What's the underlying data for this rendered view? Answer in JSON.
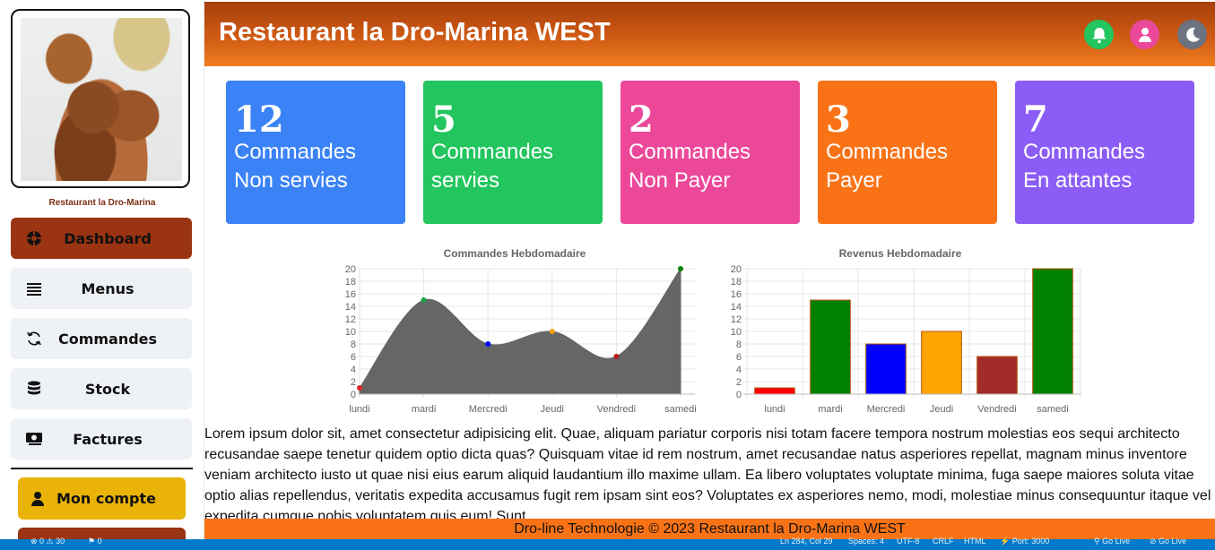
{
  "sidebar": {
    "caption": "Restaurant la Dro-Marina",
    "items": [
      {
        "label": "Dashboard",
        "icon": "dashboard-icon"
      },
      {
        "label": "Menus",
        "icon": "list-icon"
      },
      {
        "label": "Commandes",
        "icon": "refresh-icon"
      },
      {
        "label": "Stock",
        "icon": "database-icon"
      },
      {
        "label": "Factures",
        "icon": "money-bill-icon"
      }
    ],
    "account_label": "Mon compte"
  },
  "header": {
    "title": "Restaurant la Dro-Marina WEST",
    "buttons": [
      {
        "icon": "bell-icon",
        "color": "#22c55e"
      },
      {
        "icon": "user-icon",
        "color": "#ec4899"
      },
      {
        "icon": "moon-icon",
        "color": "#6b7280"
      }
    ]
  },
  "stats": [
    {
      "value": "12",
      "line1": "Commandes",
      "line2": "Non servies",
      "color": "#3b82f6"
    },
    {
      "value": "5",
      "line1": "Commandes",
      "line2": "servies",
      "color": "#22c55e"
    },
    {
      "value": "2",
      "line1": "Commandes",
      "line2": "Non Payer",
      "color": "#ec4899"
    },
    {
      "value": "3",
      "line1": "Commandes",
      "line2": "Payer",
      "color": "#f97316"
    },
    {
      "value": "7",
      "line1": "Commandes",
      "line2": "En attantes",
      "color": "#8b5cf6"
    }
  ],
  "chart_data": [
    {
      "type": "area",
      "title": "Commandes Hebdomadaire",
      "categories": [
        "lundi",
        "mardi",
        "Mercredi",
        "Jeudi",
        "Vendredi",
        "samedi"
      ],
      "values": [
        1,
        15,
        8,
        10,
        6,
        20
      ],
      "point_colors": [
        "#dc2626",
        "#16a34a",
        "#0000ff",
        "#f59e0b",
        "#b91c1c",
        "#008000"
      ],
      "fill_color": "#666666",
      "ylim": [
        0,
        20
      ],
      "yticks": [
        0,
        2,
        4,
        6,
        8,
        10,
        12,
        14,
        16,
        18,
        20
      ]
    },
    {
      "type": "bar",
      "title": "Revenus Hebdomadaire",
      "categories": [
        "lundi",
        "mardi",
        "Mercredi",
        "Jeudi",
        "Vendredi",
        "samedi"
      ],
      "values": [
        1,
        15,
        8,
        10,
        6,
        20
      ],
      "bar_colors": [
        "#ff0000",
        "#008000",
        "#0000ff",
        "#ffa500",
        "#a52a2a",
        "#008000"
      ],
      "ylim": [
        0,
        20
      ],
      "yticks": [
        0,
        2,
        4,
        6,
        8,
        10,
        12,
        14,
        16,
        18,
        20
      ]
    }
  ],
  "body_text": "Lorem ipsum dolor sit, amet consectetur adipisicing elit. Quae, aliquam pariatur corporis nisi totam facere tempora nostrum molestias eos sequi architecto recusandae saepe tenetur quidem optio dicta quas? Quisquam vitae id rem nostrum, amet recusandae natus asperiores repellat, magnam minus inventore veniam architecto iusto ut quae nisi eius earum aliquid laudantium illo maxime ullam. Ea libero voluptates voluptate minima, fuga saepe maiores soluta vitae optio alias repellendus, veritatis expedita accusamus fugit rem ipsam sint eos? Voluptates ex asperiores nemo, modi, molestiae minus consequuntur itaque vel expedita cumque nobis voluptatem quis eum! Sunt.",
  "footer": "Dro-line Technologie © 2023 Restaurant la Dro-Marina WEST",
  "statusbar": {
    "problems": "⊗ 0 ⚠ 30",
    "ports": "⚑ 0",
    "position": "Ln 284, Col 29",
    "spaces": "Spaces: 4",
    "encoding": "UTF-8",
    "eol": "CRLF",
    "language": "HTML",
    "port": "⚡ Port: 3000",
    "golive1": "⚲ Go Live",
    "golive2": "⊘ Go Live"
  }
}
